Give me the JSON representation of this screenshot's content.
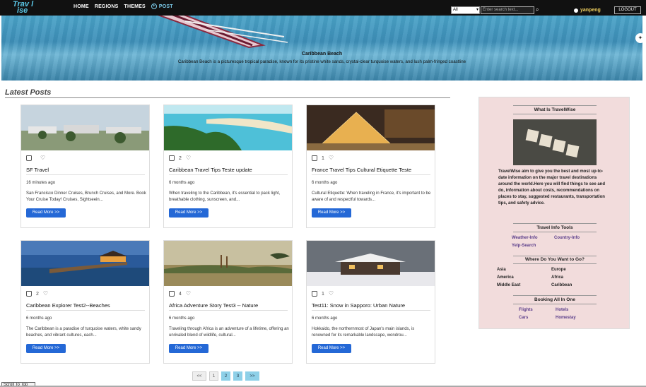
{
  "nav": {
    "logo_line1": "Trav l",
    "logo_line2": "ise",
    "links": [
      "HOME",
      "REGIONS",
      "THEMES",
      "POST"
    ],
    "search_select": "All",
    "search_placeholder": "Enter search text...",
    "username": "yanpeng",
    "logout": "LOGOUT"
  },
  "hero": {
    "title": "Caribbean Beach",
    "description": "Caribbean Beach is a picturesque tropical paradise, known for its pristine white sands, crystal-clear turquoise waters, and lush palm-fringed coastline"
  },
  "section_title": "Latest Posts",
  "posts": [
    {
      "title": "SF Travel",
      "likes": "",
      "time": "16 minutes ago",
      "text": "San Francisco Dinner Cruises, Brunch Cruises, and More. Book Your Cruise Today! Cruises, Sightseein...",
      "button": "Read More >>"
    },
    {
      "title": "Caribbean Travel Tips Teste update",
      "likes": "2",
      "time": "6 months ago",
      "text": "When traveling to the Caribbean, it's essential to pack light, breathable clothing, sunscreen, and...",
      "button": "Read More >>"
    },
    {
      "title": "France Travel Tips Cultural Etiquette Teste",
      "likes": "1",
      "time": "6 months ago",
      "text": "Cultural Etiquette: When traveling in France, it's important to be aware of and respectful towards...",
      "button": "Read More >>"
    },
    {
      "title": "Caribbean Explorer Test2--Beaches",
      "likes": "2",
      "time": "6 months ago",
      "text": "The Caribbean is a paradise of turquoise waters, white sandy beaches, and vibrant cultures, each...",
      "button": "Read More >>"
    },
    {
      "title": "Africa Adventure Story Test3 -- Nature",
      "likes": "4",
      "time": "6 months ago",
      "text": "Traveling through Africa is an adventure of a lifetime, offering an unrivaled blend of wildlife, cultural...",
      "button": "Read More >>"
    },
    {
      "title": "Test11: Snow in Sapporo: Urban Nature",
      "likes": "1",
      "time": "6 months ago",
      "text": "Hokkaido, the northernmost of Japan's main islands, is renowned for its remarkable landscape, wondrou...",
      "button": "Read More >>"
    }
  ],
  "pager": [
    "<<",
    "1",
    "2",
    "3",
    ">>"
  ],
  "scroll_top": "Scroll To Top",
  "sidebar": {
    "about_title": "What Is TravelWise",
    "about_text": "TravelWise aim to give you the best and most up-to-date information on the major travel destinations around the world.Here you will find things to see and do, information about costs, recommendations on places to stay, suggested restaurants, transportation tips, and safety advice.",
    "tools_title": "Travel Info Tools",
    "tools": [
      "Weather-Info",
      "Country-Info",
      "Yelp-Search"
    ],
    "where_title": "Where Do You Want to Go?",
    "regions": [
      "Asia",
      "Europe",
      "America",
      "Africa",
      "Middle East",
      "Caribbean"
    ],
    "booking_title": "Booking All In One",
    "booking": [
      "Flights",
      "Hotels",
      "Cars",
      "Homestay"
    ]
  }
}
